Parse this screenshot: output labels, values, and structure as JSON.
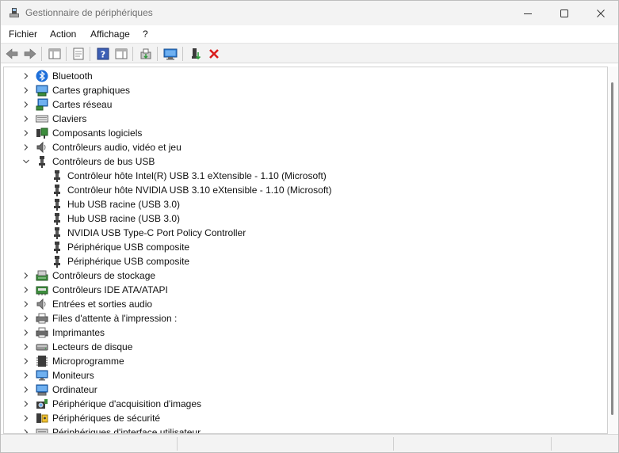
{
  "window": {
    "title": "Gestionnaire de périphériques",
    "minimize_icon": "minimize-icon",
    "maximize_icon": "maximize-icon",
    "close_icon": "close-icon"
  },
  "menu": {
    "items": [
      "Fichier",
      "Action",
      "Affichage",
      "?"
    ]
  },
  "toolbar": {
    "buttons": [
      "back-arrow-icon",
      "forward-arrow-icon",
      "show-hide-console-tree-icon",
      "properties-icon",
      "help-icon",
      "action-pane-icon",
      "update-driver-icon",
      "scan-hardware-icon",
      "enable-device-icon",
      "uninstall-device-icon"
    ]
  },
  "tree": {
    "categories": [
      {
        "label": "Bluetooth",
        "icon": "bluetooth-icon"
      },
      {
        "label": "Cartes graphiques",
        "icon": "display-adapter-icon"
      },
      {
        "label": "Cartes réseau",
        "icon": "network-adapter-icon"
      },
      {
        "label": "Claviers",
        "icon": "keyboard-icon"
      },
      {
        "label": "Composants logiciels",
        "icon": "software-component-icon"
      },
      {
        "label": "Contrôleurs audio, vidéo et jeu",
        "icon": "audio-icon"
      },
      {
        "label": "Contrôleurs de bus USB",
        "icon": "usb-icon",
        "expanded": true,
        "children": [
          "Contrôleur hôte Intel(R) USB 3.1 eXtensible - 1.10 (Microsoft)",
          "Contrôleur hôte NVIDIA USB 3.10 eXtensible - 1.10 (Microsoft)",
          "Hub USB racine (USB 3.0)",
          "Hub USB racine (USB 3.0)",
          "NVIDIA USB Type-C Port Policy Controller",
          "Périphérique USB composite",
          "Périphérique USB composite"
        ]
      },
      {
        "label": "Contrôleurs de stockage",
        "icon": "storage-controller-icon"
      },
      {
        "label": "Contrôleurs IDE ATA/ATAPI",
        "icon": "ide-controller-icon"
      },
      {
        "label": "Entrées et sorties audio",
        "icon": "audio-io-icon"
      },
      {
        "label": "Files d'attente à l'impression :",
        "icon": "print-queue-icon"
      },
      {
        "label": "Imprimantes",
        "icon": "printer-icon"
      },
      {
        "label": "Lecteurs de disque",
        "icon": "disk-drive-icon"
      },
      {
        "label": "Microprogramme",
        "icon": "firmware-icon"
      },
      {
        "label": "Moniteurs",
        "icon": "monitor-icon"
      },
      {
        "label": "Ordinateur",
        "icon": "computer-icon"
      },
      {
        "label": "Périphérique d'acquisition d'images",
        "icon": "imaging-device-icon"
      },
      {
        "label": "Périphériques de sécurité",
        "icon": "security-device-icon"
      },
      {
        "label": "Périphériques d'interface utilisateur",
        "icon": "hid-icon"
      }
    ]
  }
}
